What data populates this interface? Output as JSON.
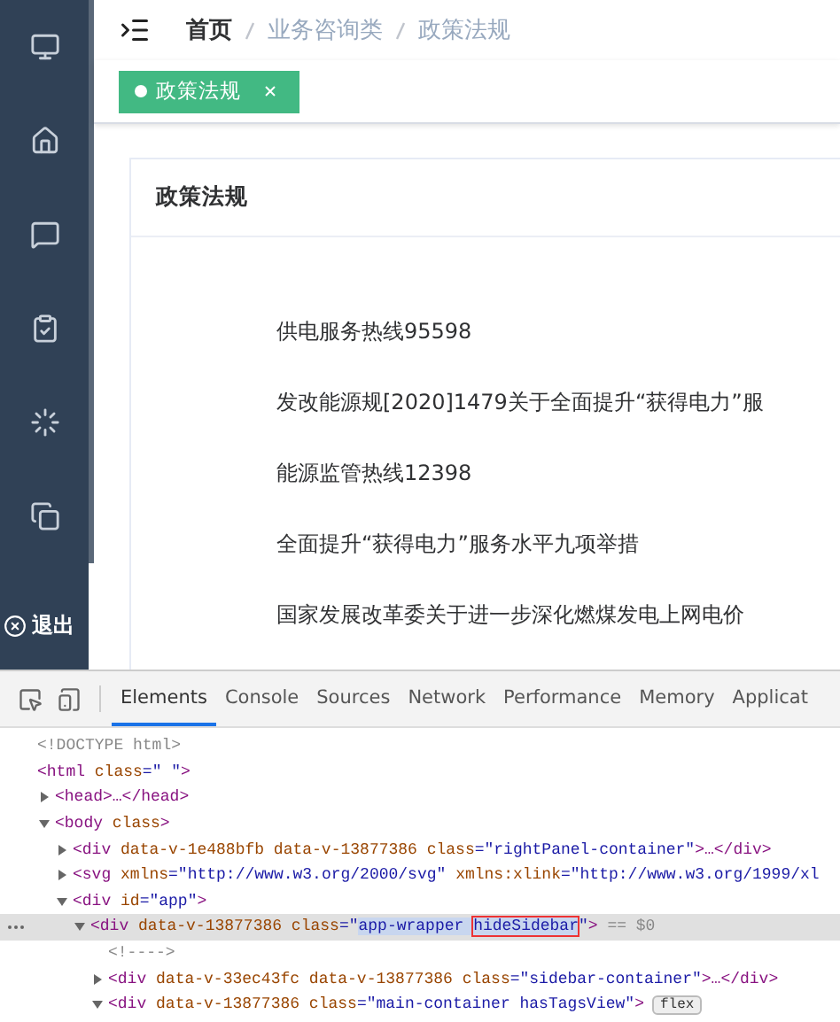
{
  "sidebar": {
    "logout": {
      "label": "退出"
    }
  },
  "breadcrumb": [
    {
      "label": "首页",
      "kind": "link"
    },
    {
      "label": "业务咨询类",
      "kind": "plain"
    },
    {
      "label": "政策法规",
      "kind": "plain"
    }
  ],
  "tags": [
    {
      "label": "政策法规",
      "selected": true
    }
  ],
  "card": {
    "title": "政策法规",
    "links": [
      "供电服务热线95598",
      "发改能源规[2020]1479关于全面提升“获得电力”服",
      "能源监管热线12398",
      "全面提升“获得电力”服务水平九项举措",
      "国家发展改革委关于进一步深化燃煤发电上网电价"
    ]
  },
  "devtools": {
    "tabs": [
      {
        "label": "Elements",
        "selected": true
      },
      {
        "label": "Console",
        "selected": false
      },
      {
        "label": "Sources",
        "selected": false
      },
      {
        "label": "Network",
        "selected": false
      },
      {
        "label": "Performance",
        "selected": false
      },
      {
        "label": "Memory",
        "selected": false
      },
      {
        "label": "Applicat",
        "selected": false
      }
    ],
    "dom": [
      {
        "parts": [
          {
            "text": "<!DOCTYPE html>",
            "kind": "grey"
          }
        ]
      },
      {
        "parts": [
          {
            "text": "<html ",
            "kind": "tag"
          },
          {
            "text": "class",
            "kind": "attr"
          },
          {
            "text": "=\" \"",
            "kind": "value"
          },
          {
            "text": ">",
            "kind": "tag"
          }
        ],
        "children": [
          {
            "expanded": false,
            "parts": [
              {
                "text": "<head>…</head>",
                "kind": "tag"
              }
            ]
          },
          {
            "expanded": true,
            "parts": [
              {
                "text": "<body ",
                "kind": "tag"
              },
              {
                "text": "class",
                "kind": "attr"
              },
              {
                "text": ">",
                "kind": "tag"
              }
            ],
            "children": [
              {
                "expanded": false,
                "parts": [
                  {
                    "text": "<div ",
                    "kind": "tag"
                  },
                  {
                    "text": "data-v-1e488bfb data-v-13877386 class",
                    "kind": "attr"
                  },
                  {
                    "text": "=\"rightPanel-container\"",
                    "kind": "value"
                  },
                  {
                    "text": ">…</div>",
                    "kind": "tag"
                  }
                ]
              },
              {
                "expanded": false,
                "parts": [
                  {
                    "text": "<svg ",
                    "kind": "tag"
                  },
                  {
                    "text": "xmlns",
                    "kind": "attr"
                  },
                  {
                    "text": "=\"http://www.w3.org/2000/svg\" ",
                    "kind": "value"
                  },
                  {
                    "text": "xmlns:xlink",
                    "kind": "attr"
                  },
                  {
                    "text": "=\"http://www.w3.org/1999/xl",
                    "kind": "value"
                  }
                ]
              },
              {
                "expanded": true,
                "parts": [
                  {
                    "text": "<div ",
                    "kind": "tag"
                  },
                  {
                    "text": "id",
                    "kind": "attr"
                  },
                  {
                    "text": "=\"app\"",
                    "kind": "value"
                  },
                  {
                    "text": ">",
                    "kind": "tag"
                  }
                ],
                "children": [
                  {
                    "expanded": true,
                    "selected": true,
                    "parts": [
                      {
                        "text": "<div ",
                        "kind": "tag"
                      },
                      {
                        "text": "data-v-13877386 class",
                        "kind": "attr"
                      },
                      {
                        "text": "=\"",
                        "kind": "value"
                      },
                      {
                        "text": "app-wrapper ",
                        "kind": "highlight"
                      },
                      {
                        "text": "hideSidebar",
                        "kind": "boxed"
                      },
                      {
                        "text": "\"",
                        "kind": "value"
                      },
                      {
                        "text": ">",
                        "kind": "tag"
                      },
                      {
                        "text": " == $0",
                        "kind": "grey"
                      }
                    ],
                    "children": [
                      {
                        "parts": [
                          {
                            "text": "<!---->",
                            "kind": "grey"
                          }
                        ]
                      },
                      {
                        "expanded": false,
                        "parts": [
                          {
                            "text": "<div ",
                            "kind": "tag"
                          },
                          {
                            "text": "data-v-33ec43fc data-v-13877386 class",
                            "kind": "attr"
                          },
                          {
                            "text": "=\"sidebar-container\"",
                            "kind": "value"
                          },
                          {
                            "text": ">…</div>",
                            "kind": "tag"
                          }
                        ]
                      },
                      {
                        "expanded": true,
                        "badge": "flex",
                        "parts": [
                          {
                            "text": "<div ",
                            "kind": "tag"
                          },
                          {
                            "text": "data-v-13877386 class",
                            "kind": "attr"
                          },
                          {
                            "text": "=\"main-container hasTagsView\"",
                            "kind": "value"
                          },
                          {
                            "text": ">",
                            "kind": "tag"
                          }
                        ]
                      }
                    ]
                  }
                ]
              }
            ]
          }
        ]
      }
    ]
  }
}
